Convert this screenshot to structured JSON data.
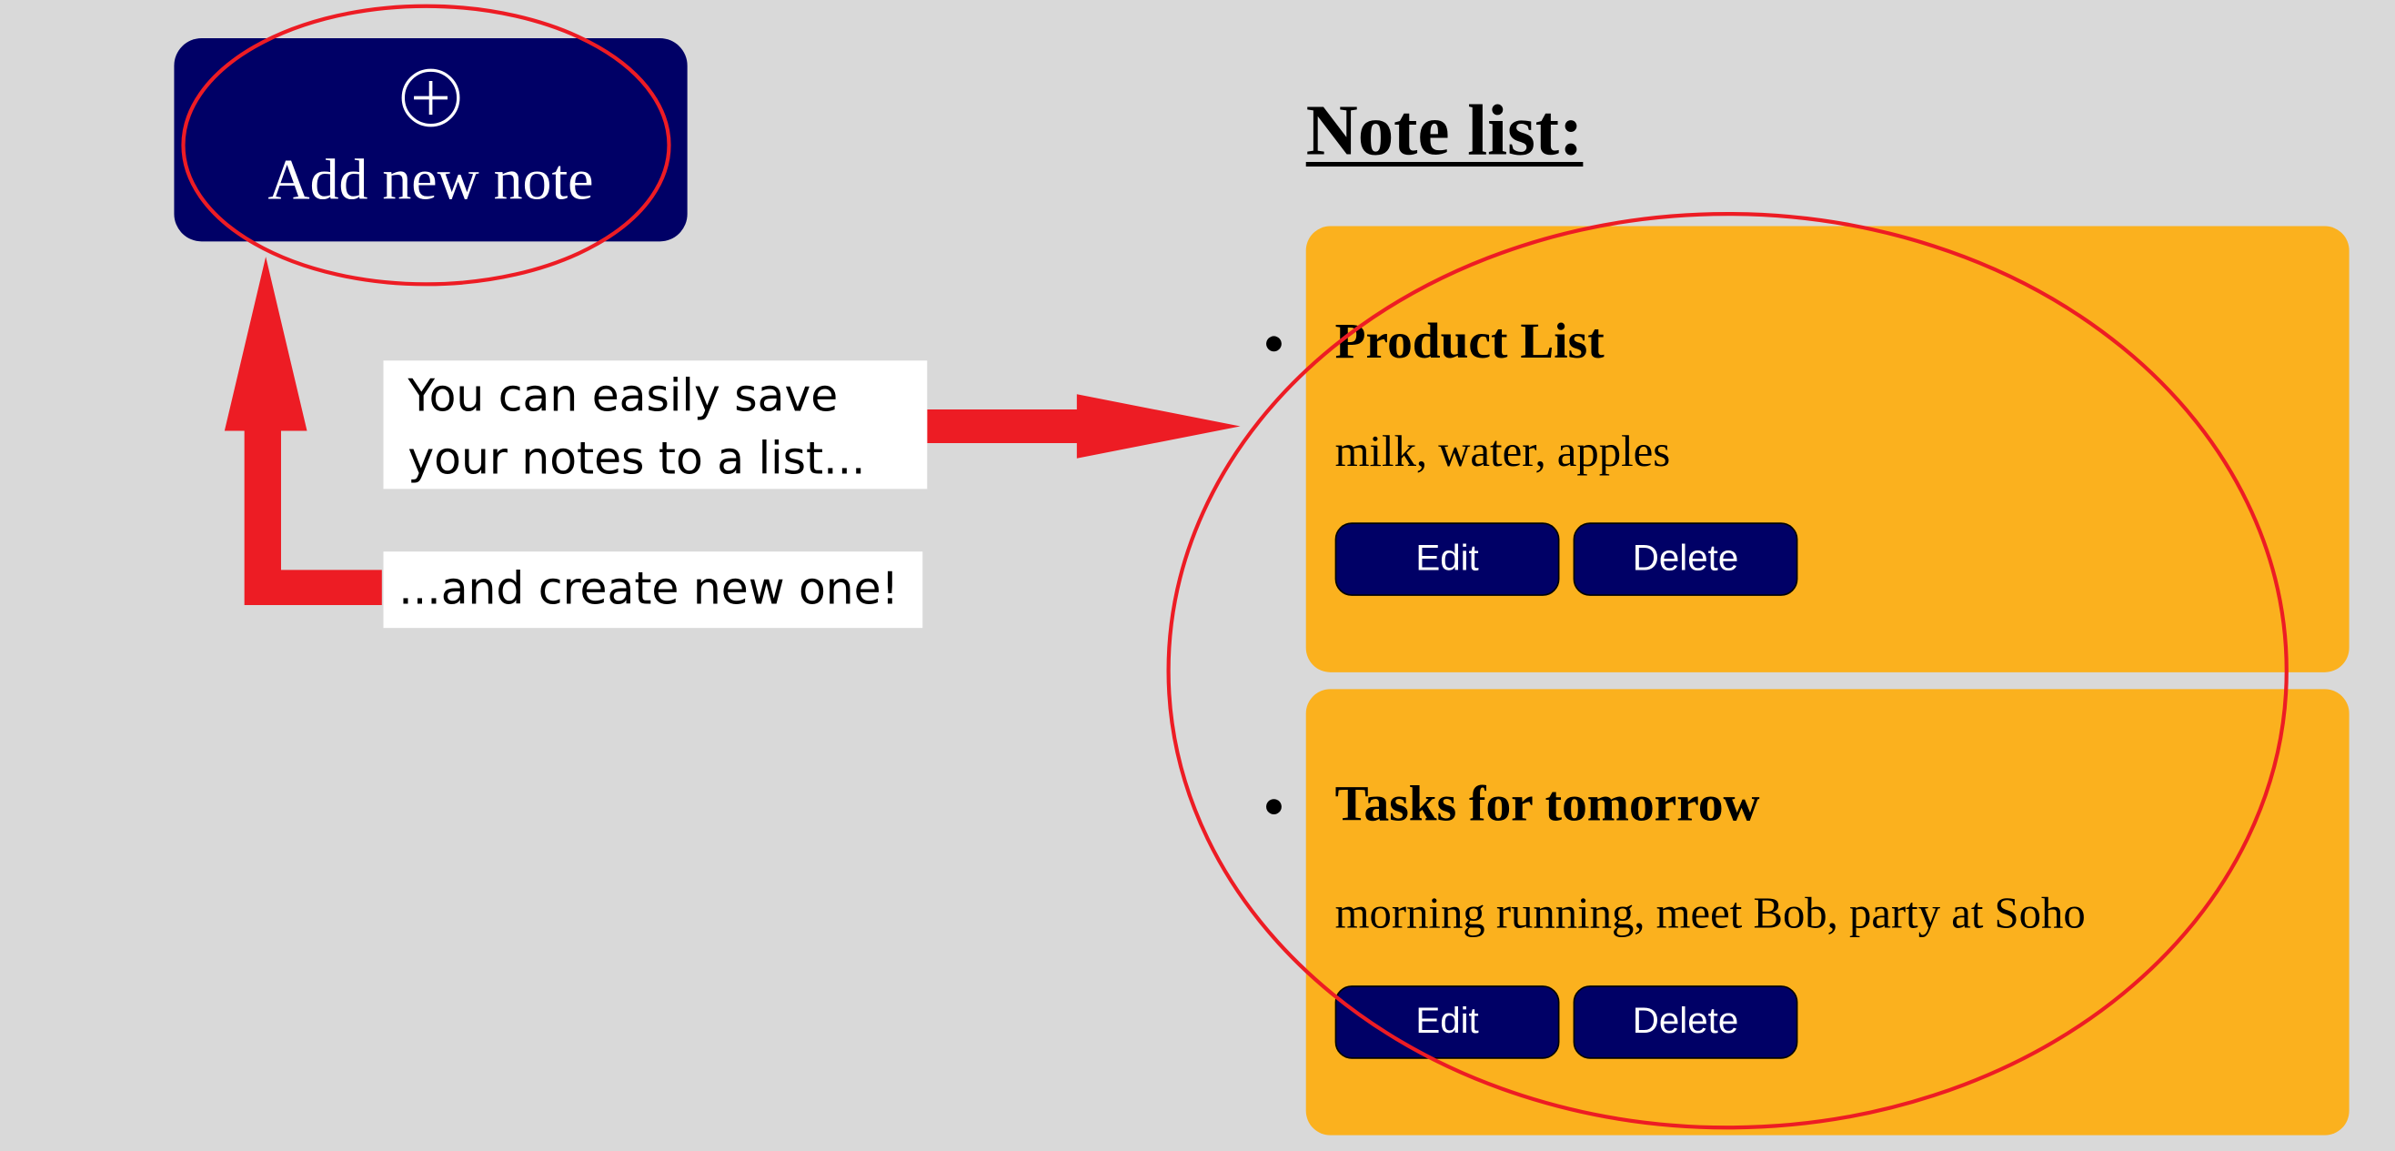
{
  "add_note": {
    "label": "Add new note",
    "icon": "plus-circle-icon"
  },
  "note_list": {
    "heading": "Note list:",
    "notes": [
      {
        "title": "Product List",
        "content": "milk, water, apples",
        "edit_label": "Edit",
        "delete_label": "Delete"
      },
      {
        "title": "Tasks for tomorrow",
        "content": "morning running, meet Bob, party at Soho",
        "edit_label": "Edit",
        "delete_label": "Delete"
      }
    ]
  },
  "annotations": {
    "callout_save": [
      "You can easily save",
      "your notes to a list..."
    ],
    "callout_create": "...and create new one!"
  },
  "colors": {
    "background": "#d9d9d9",
    "button": "#000066",
    "note_card": "#fbb11e",
    "annotation": "#ed1c24"
  }
}
